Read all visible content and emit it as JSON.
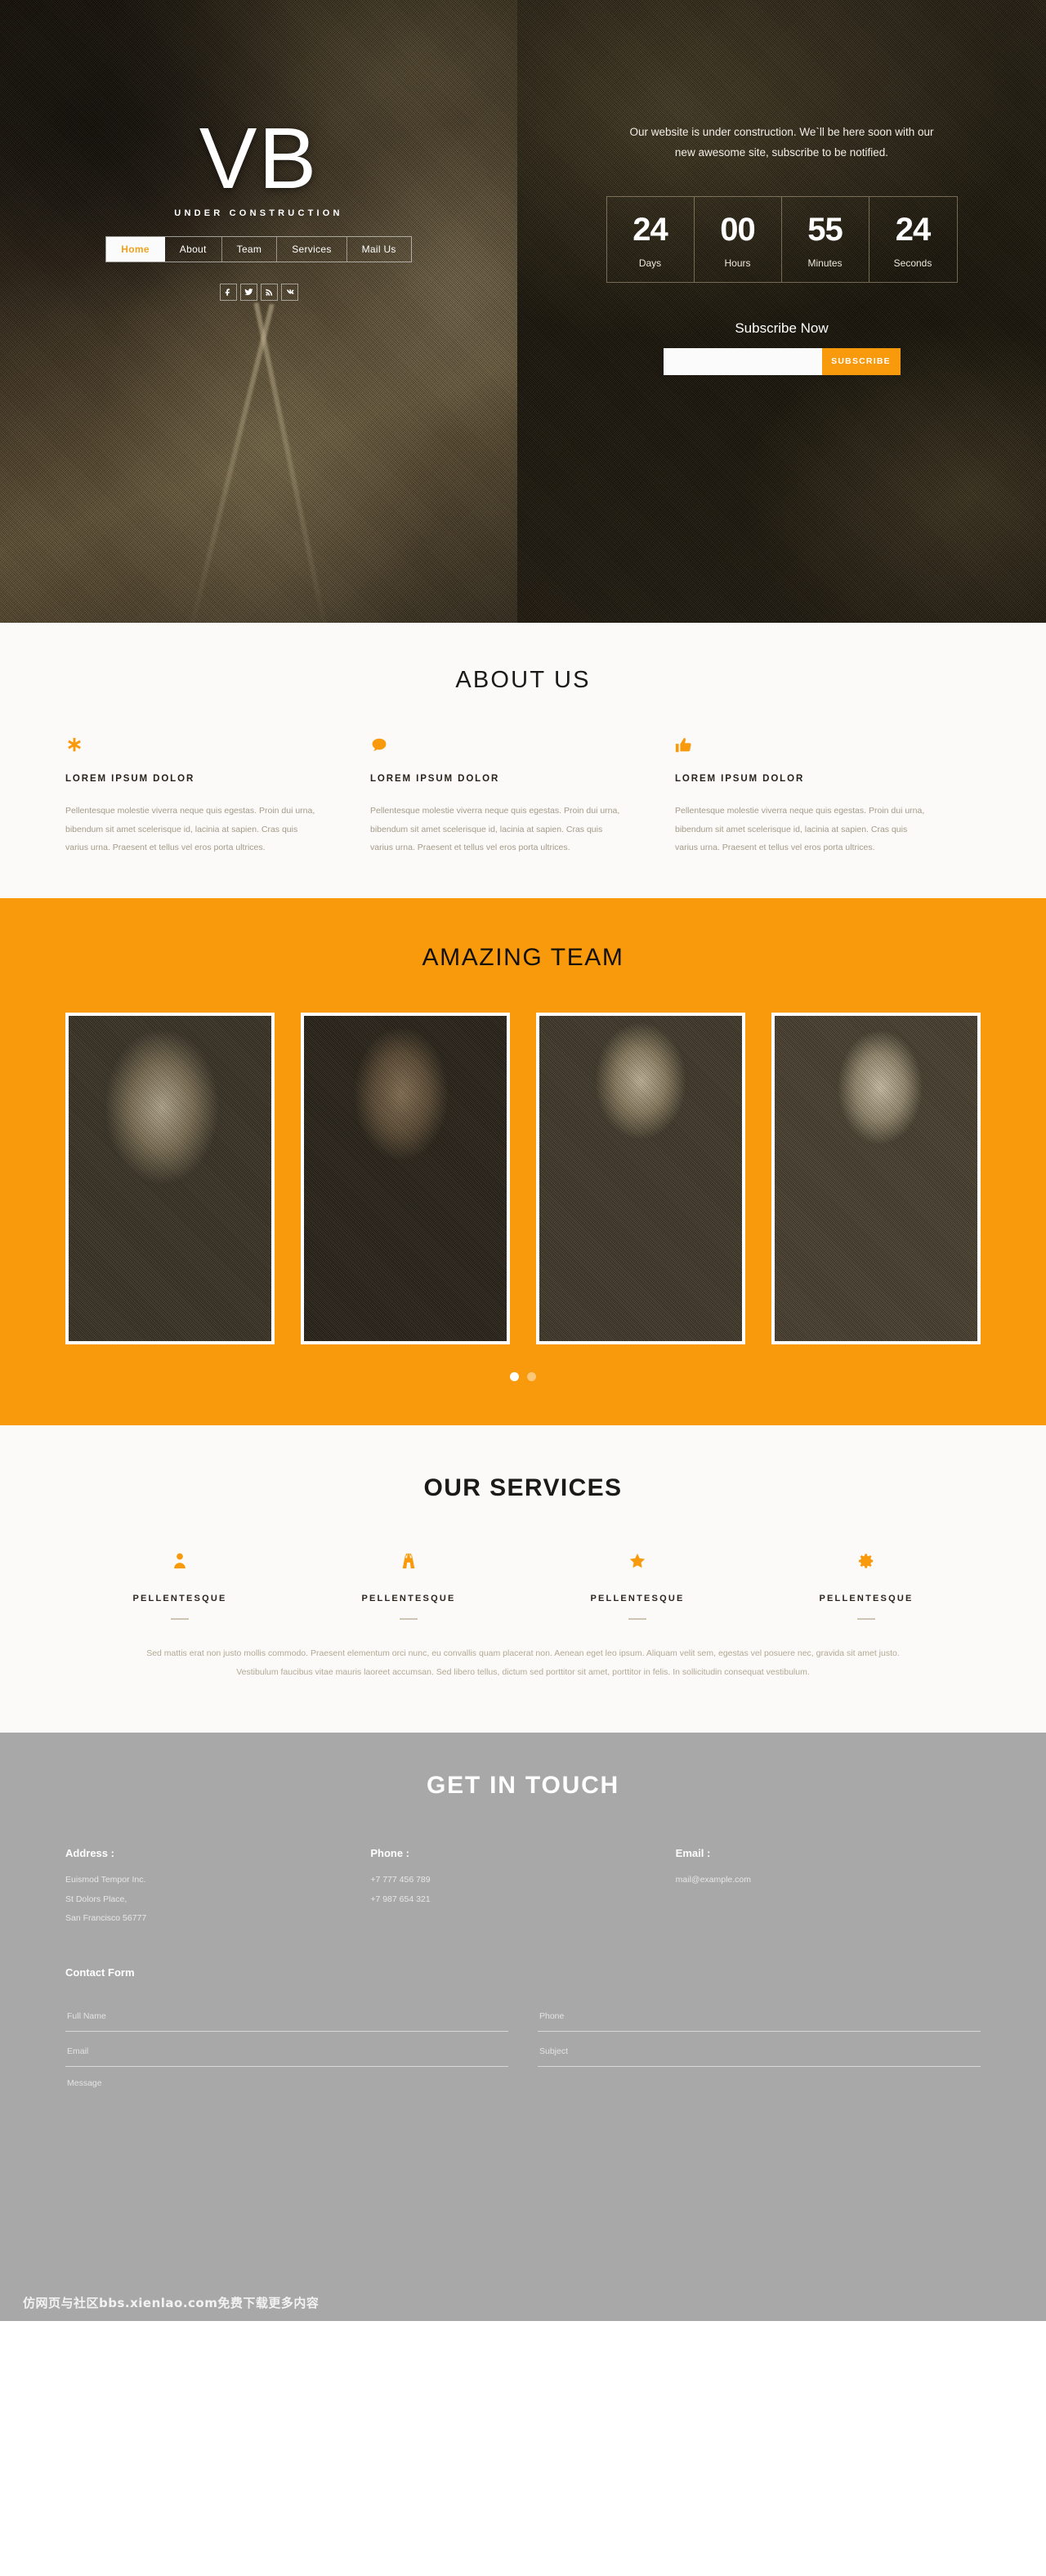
{
  "hero": {
    "logo": "VB",
    "tagline": "UNDER CONSTRUCTION",
    "nav": [
      {
        "label": "Home",
        "active": true
      },
      {
        "label": "About",
        "active": false
      },
      {
        "label": "Team",
        "active": false
      },
      {
        "label": "Services",
        "active": false
      },
      {
        "label": "Mail Us",
        "active": false
      }
    ],
    "socials": [
      {
        "name": "facebook-icon"
      },
      {
        "name": "twitter-icon"
      },
      {
        "name": "rss-icon"
      },
      {
        "name": "vk-icon"
      }
    ],
    "intro": "Our website is under construction. We`ll be here soon with our new awesome site, subscribe to be notified.",
    "countdown": [
      {
        "value": "24",
        "label": "Days"
      },
      {
        "value": "00",
        "label": "Hours"
      },
      {
        "value": "55",
        "label": "Minutes"
      },
      {
        "value": "24",
        "label": "Seconds"
      }
    ],
    "subscribe_title": "Subscribe Now",
    "subscribe_placeholder": "",
    "subscribe_value": "",
    "subscribe_button": "SUBSCRIBE"
  },
  "about": {
    "title": "ABOUT US",
    "columns": [
      {
        "icon": "asterisk-icon",
        "heading": "LOREM IPSUM DOLOR",
        "body": "Pellentesque molestie viverra neque quis egestas. Proin dui urna, bibendum sit amet scelerisque id, lacinia at sapien. Cras quis varius urna. Praesent et tellus vel eros porta ultrices."
      },
      {
        "icon": "comment-icon",
        "heading": "LOREM IPSUM DOLOR",
        "body": "Pellentesque molestie viverra neque quis egestas. Proin dui urna, bibendum sit amet scelerisque id, lacinia at sapien. Cras quis varius urna. Praesent et tellus vel eros porta ultrices."
      },
      {
        "icon": "thumbs-up-icon",
        "heading": "LOREM IPSUM DOLOR",
        "body": "Pellentesque molestie viverra neque quis egestas. Proin dui urna, bibendum sit amet scelerisque id, lacinia at sapien. Cras quis varius urna. Praesent et tellus vel eros porta ultrices."
      }
    ]
  },
  "team": {
    "title": "AMAZING TEAM",
    "members": [
      {
        "name": "team-photo-1"
      },
      {
        "name": "team-photo-2"
      },
      {
        "name": "team-photo-3"
      },
      {
        "name": "team-photo-4"
      }
    ],
    "dots": [
      {
        "active": true
      },
      {
        "active": false
      }
    ]
  },
  "services": {
    "title": "OUR SERVICES",
    "items": [
      {
        "icon": "user-icon",
        "label": "PELLENTESQUE"
      },
      {
        "icon": "road-icon",
        "label": "PELLENTESQUE"
      },
      {
        "icon": "star-icon",
        "label": "PELLENTESQUE"
      },
      {
        "icon": "gear-icon",
        "label": "PELLENTESQUE"
      }
    ],
    "body": "Sed mattis erat non justo mollis commodo. Praesent elementum orci nunc, eu convallis quam placerat non. Aenean eget leo ipsum. Aliquam velit sem, egestas vel posuere nec, gravida sit amet justo. Vestibulum faucibus vitae mauris laoreet accumsan. Sed libero tellus, dictum sed porttitor sit amet, porttitor in felis. In sollicitudin consequat vestibulum."
  },
  "contact": {
    "title": "GET IN TOUCH",
    "address_label": "Address :",
    "address_lines": [
      "Euismod Tempor Inc.",
      "St Dolors Place,",
      "San Francisco 56777"
    ],
    "phone_label": "Phone :",
    "phone_lines": [
      "+7 777 456 789",
      "+7 987 654 321"
    ],
    "email_label": "Email :",
    "email_lines": [
      "mail@example.com"
    ],
    "form_title": "Contact Form",
    "fields": {
      "full_name": "Full Name",
      "phone": "Phone",
      "email": "Email",
      "subject": "Subject",
      "message": "Message"
    }
  },
  "watermark": "仿网页与社区bbs.xienlao.com免费下载更多内容",
  "colors": {
    "accent": "#f89a0c",
    "dark": "#221d12",
    "contact_bg": "#a8a8a8",
    "light_bg": "#fbfaf8"
  }
}
